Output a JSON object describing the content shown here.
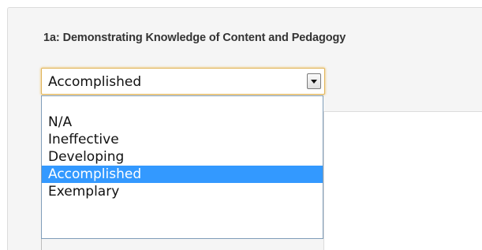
{
  "component": {
    "title": "1a:  Demonstrating Knowledge of Content and Pedagogy"
  },
  "rating_select": {
    "current_value": "Accomplished",
    "options": [
      {
        "label": "",
        "selected": false
      },
      {
        "label": "N/A",
        "selected": false
      },
      {
        "label": "Ineffective",
        "selected": false
      },
      {
        "label": "Developing",
        "selected": false
      },
      {
        "label": "Accomplished",
        "selected": true
      },
      {
        "label": "Exemplary",
        "selected": false
      }
    ]
  },
  "colors": {
    "highlight": "#3399ff",
    "focus_border": "#e0b55a",
    "list_border": "#7f9db9",
    "panel_background": "#f5f5f5"
  }
}
